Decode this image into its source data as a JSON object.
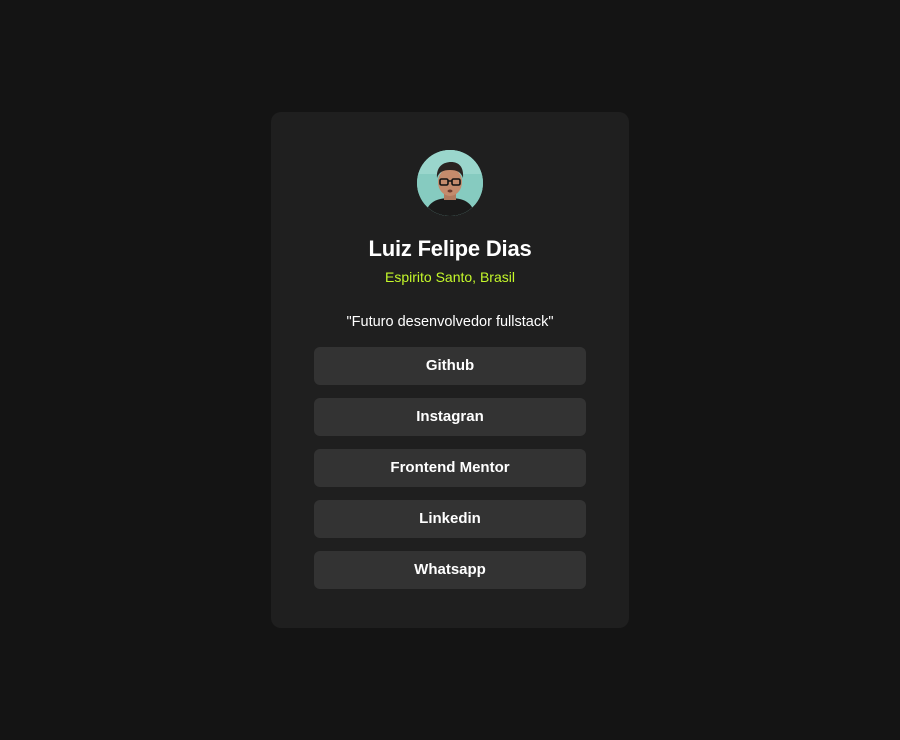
{
  "profile": {
    "name": "Luiz Felipe Dias",
    "location": "Espirito Santo, Brasil",
    "bio": "\"Futuro desenvolvedor fullstack\"",
    "avatar_icon": "profile-photo"
  },
  "links": [
    {
      "label": "Github"
    },
    {
      "label": "Instagran"
    },
    {
      "label": "Frontend Mentor"
    },
    {
      "label": "Linkedin"
    },
    {
      "label": "Whatsapp"
    }
  ],
  "colors": {
    "background": "#141414",
    "card": "#1f1f1f",
    "button": "#333333",
    "accent": "#c4f82a",
    "text": "#ffffff"
  }
}
